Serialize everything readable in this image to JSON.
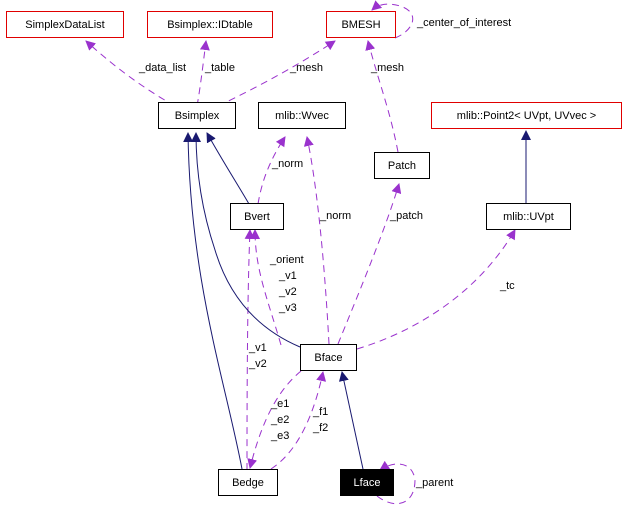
{
  "diagram": {
    "type": "collaboration-graph",
    "focus": "Lface",
    "colors": {
      "inheritance_edge": "#191970",
      "usage_edge": "#9a32cd",
      "external_class_border": "#e00000",
      "class_border": "#000000",
      "focus_fill": "#000000",
      "focus_text": "#ffffff"
    },
    "nodes": {
      "simplexdatalist": {
        "label": "SimplexDataList",
        "external": true
      },
      "idtable": {
        "label": "Bsimplex::IDtable",
        "external": true
      },
      "bmesh": {
        "label": "BMESH",
        "external": true
      },
      "bsimplex": {
        "label": "Bsimplex",
        "external": false
      },
      "wvec": {
        "label": "mlib::Wvec",
        "external": false
      },
      "point2": {
        "label": "mlib::Point2< UVpt, UVvec >",
        "external": true
      },
      "patch": {
        "label": "Patch",
        "external": false
      },
      "bvert": {
        "label": "Bvert",
        "external": false
      },
      "uvpt": {
        "label": "mlib::UVpt",
        "external": false
      },
      "bface": {
        "label": "Bface",
        "external": false
      },
      "bedge": {
        "label": "Bedge",
        "external": false
      },
      "lface": {
        "label": "Lface",
        "external": false
      }
    },
    "edge_labels": {
      "data_list": "_data_list",
      "table": "_table",
      "mesh_bsimplex": "_mesh",
      "center_of_interest": "_center_of_interest",
      "mesh_patch": "_mesh",
      "norm_bvert": "_norm",
      "norm_bface": "_norm",
      "patch": "_patch",
      "tc": "_tc",
      "bvert_refs": [
        "_orient",
        "_v1",
        "_v2",
        "_v3"
      ],
      "bedge_verts": [
        "_v1",
        "_v2"
      ],
      "bedge_edges": [
        "_e1",
        "_e2",
        "_e3"
      ],
      "bedge_faces": [
        "_f1",
        "_f2"
      ],
      "parent": "_parent"
    }
  }
}
